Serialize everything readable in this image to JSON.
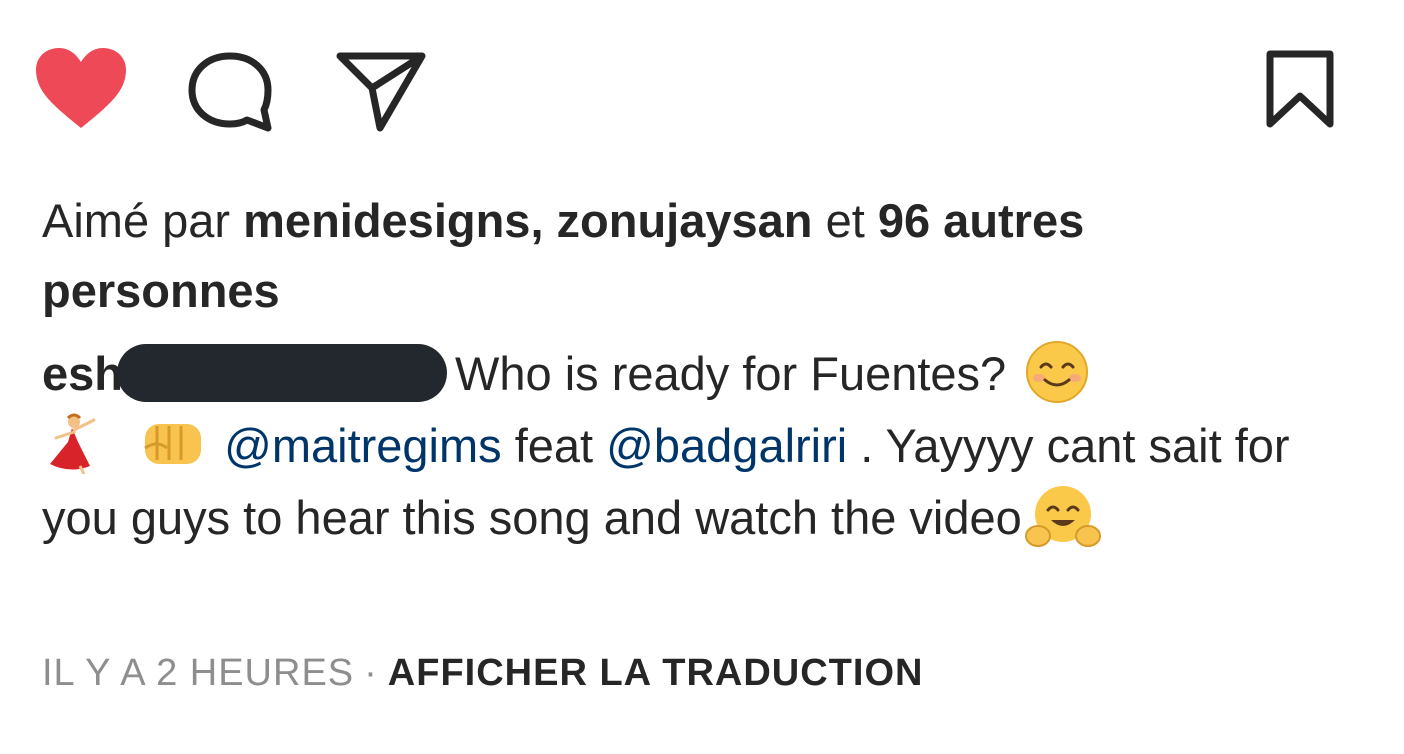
{
  "actions": {
    "like_icon": "heart-filled-icon",
    "comment_icon": "comment-bubble-icon",
    "share_icon": "paper-plane-icon",
    "save_icon": "bookmark-icon",
    "like_color": "#ed4956"
  },
  "likes": {
    "prefix": "Aimé par ",
    "users": "menidesigns, zonujaysan",
    "connector": " et ",
    "others": "96 autres personnes"
  },
  "caption": {
    "username": "esh",
    "text_1": "Who is ready for Fuentes?",
    "mention_1": "@maitregims",
    "text_2": " feat ",
    "mention_2": "@badgalriri",
    "text_3": " . Yayyyy cant sait for you guys to hear this song and watch the video"
  },
  "meta": {
    "time": "IL Y A 2 HEURES",
    "separator": "·",
    "translate": "AFFICHER LA TRADUCTION"
  }
}
